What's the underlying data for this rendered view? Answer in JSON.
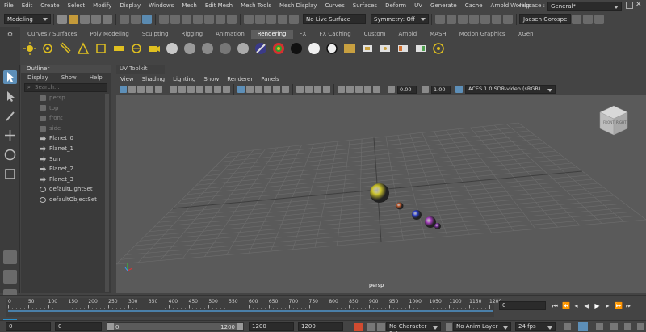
{
  "menubar": {
    "items": [
      "File",
      "Edit",
      "Create",
      "Select",
      "Modify",
      "Display",
      "Windows",
      "Mesh",
      "Edit Mesh",
      "Mesh Tools",
      "Mesh Display",
      "Curves",
      "Surfaces",
      "Deform",
      "UV",
      "Generate",
      "Cache",
      "Arnold",
      "Help"
    ],
    "workspace_label": "Workspace :",
    "workspace_value": "General*"
  },
  "statusline": {
    "mode": "Modeling",
    "live_surface": "No Live Surface",
    "symmetry": "Symmetry: Off",
    "user": "Jaesen Gorospe"
  },
  "shelf": {
    "tabs": [
      "Curves / Surfaces",
      "Poly Modeling",
      "Sculpting",
      "Rigging",
      "Animation",
      "Rendering",
      "FX",
      "FX Caching",
      "Custom",
      "Arnold",
      "MASH",
      "Motion Graphics",
      "XGen"
    ],
    "active_tab": "Rendering"
  },
  "outliner": {
    "title": "Outliner",
    "menus": [
      "Display",
      "Show",
      "Help"
    ],
    "search_placeholder": "Search...",
    "items": [
      {
        "label": "persp",
        "dim": true,
        "icon": "camera-icon"
      },
      {
        "label": "top",
        "dim": true,
        "icon": "camera-icon"
      },
      {
        "label": "front",
        "dim": true,
        "icon": "camera-icon"
      },
      {
        "label": "side",
        "dim": true,
        "icon": "camera-icon"
      },
      {
        "label": "Planet_0",
        "dim": false,
        "icon": "group-icon"
      },
      {
        "label": "Planet_1",
        "dim": false,
        "icon": "group-icon"
      },
      {
        "label": "Sun",
        "dim": false,
        "icon": "group-icon"
      },
      {
        "label": "Planet_2",
        "dim": false,
        "icon": "group-icon"
      },
      {
        "label": "Planet_3",
        "dim": false,
        "icon": "group-icon"
      },
      {
        "label": "defaultLightSet",
        "dim": false,
        "icon": "set-icon"
      },
      {
        "label": "defaultObjectSet",
        "dim": false,
        "icon": "set-icon"
      }
    ]
  },
  "viewport": {
    "panel_tab": "UV Toolkit",
    "menus": [
      "View",
      "Shading",
      "Lighting",
      "Show",
      "Renderer",
      "Panels"
    ],
    "field_a": "0.00",
    "field_b": "1.00",
    "color_space": "ACES 1.0 SDR-video (sRGB)",
    "camera": "persp",
    "viewcube_labels": [
      "FRONT",
      "RIGHT"
    ]
  },
  "timeslider": {
    "ticks": [
      "0",
      "50",
      "100",
      "150",
      "200",
      "250",
      "300",
      "350",
      "400",
      "450",
      "500",
      "550",
      "600",
      "650",
      "700",
      "750",
      "800",
      "850",
      "900",
      "950",
      "1000",
      "1050",
      "1100",
      "1150",
      "1200"
    ],
    "current_frame": "0"
  },
  "rangebar": {
    "start": "0",
    "anim_start": "0",
    "slider_start": "0",
    "slider_end": "1200",
    "anim_end": "1200",
    "end": "1200",
    "character_set": "No Character Set",
    "anim_layer": "No Anim Layer",
    "fps": "24 fps"
  },
  "colors": {
    "sun": "#c9c12a",
    "planet_0": "#b5542a",
    "planet_1": "#2b3fd0",
    "planet_2": "#a13bb8",
    "planet_3": "#7a2aa0",
    "accent": "#5d8fb8"
  }
}
